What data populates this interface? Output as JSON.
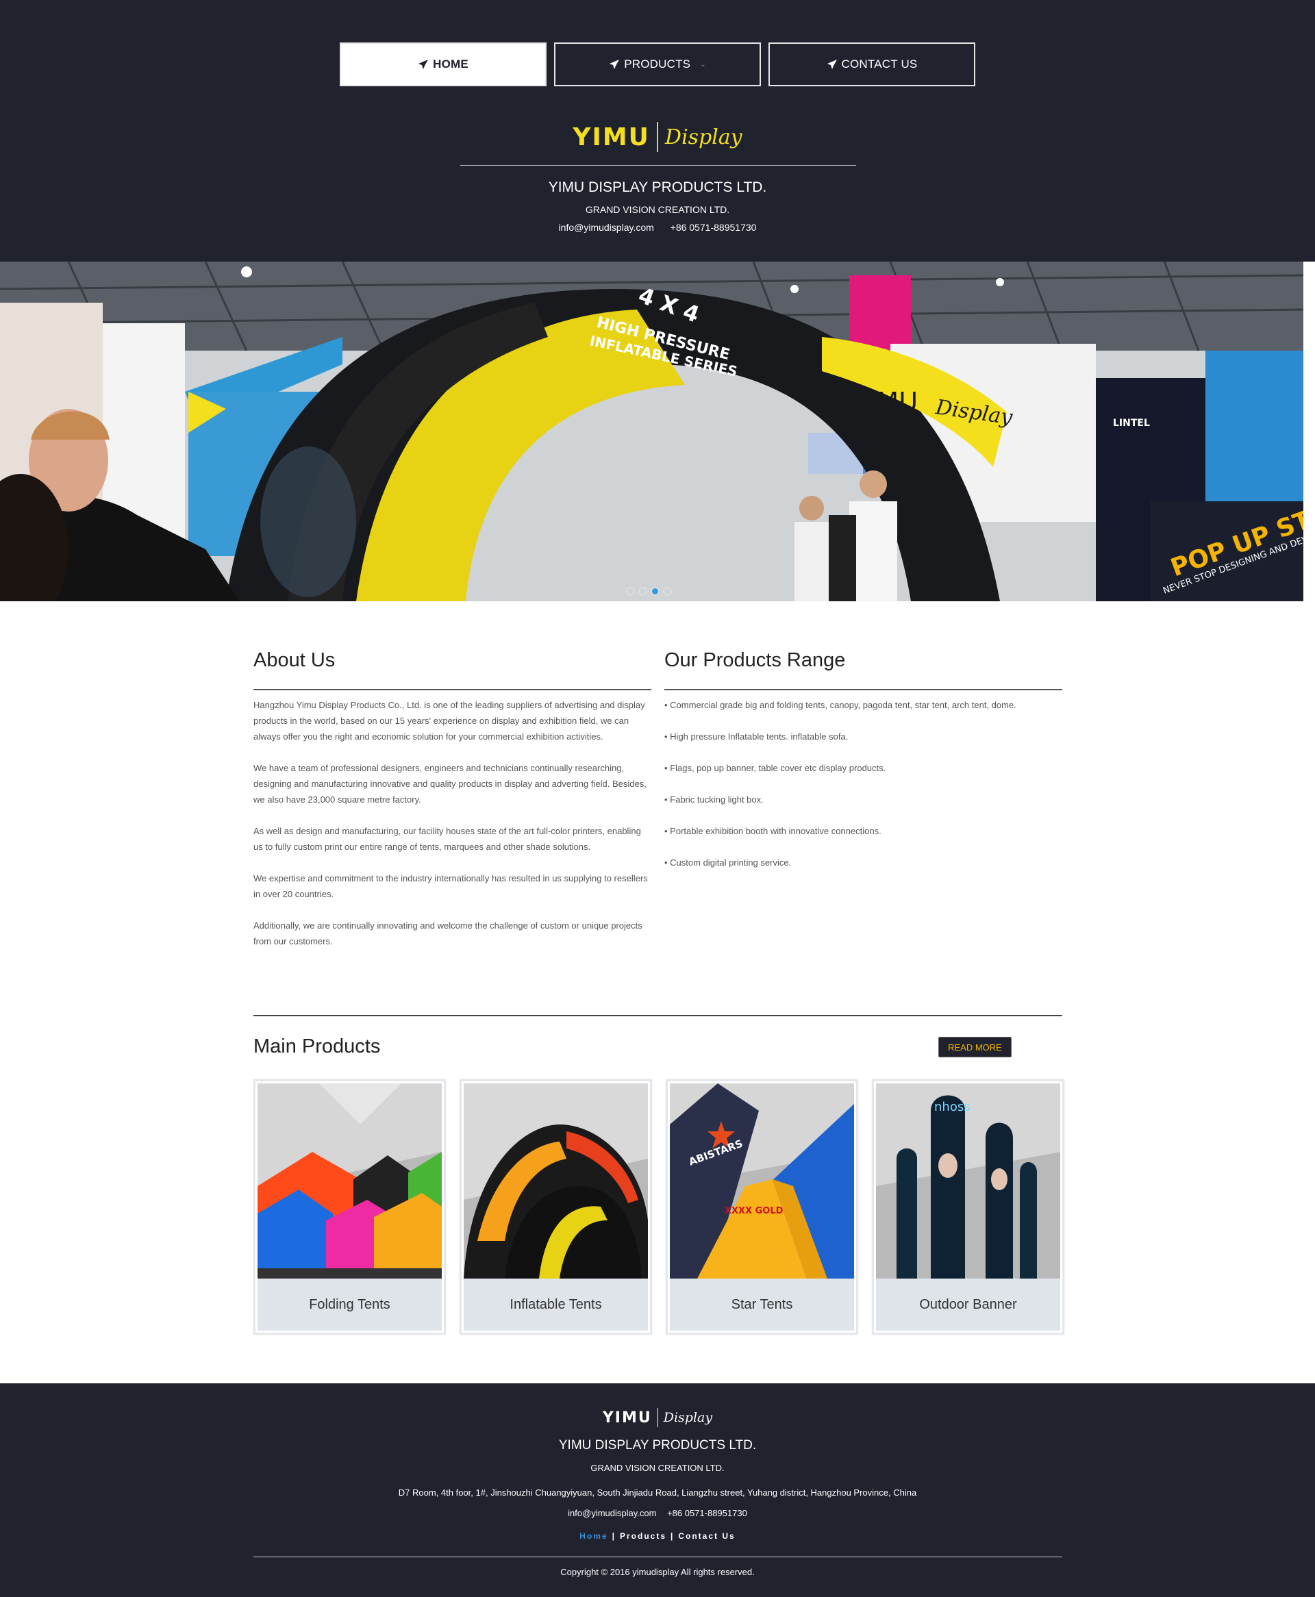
{
  "nav": {
    "items": [
      {
        "label": "HOME"
      },
      {
        "label": "PRODUCTS"
      },
      {
        "label": "CONTACT US"
      }
    ]
  },
  "header": {
    "logo_main": "YIMU",
    "logo_script": "Display",
    "company": "YIMU DISPLAY PRODUCTS LTD.",
    "subcompany": "GRAND VISION CREATION LTD.",
    "email": "info@yimudisplay.com",
    "phone": "+86  0571-88951730"
  },
  "hero": {
    "overlay_top": "4 X 4",
    "overlay_line1": "HIGH PRESSURE",
    "overlay_line2": "INFLATABLE SERIES",
    "arch_brand": "YIMU",
    "arch_script": "Display",
    "popup_line1": "POP UP STAND",
    "popup_line2": "NEVER STOP DESIGNING AND DEVELOPING",
    "lintel": "LINTEL",
    "active_slide": 3,
    "slide_count": 4
  },
  "about": {
    "title": "About Us",
    "paragraphs": [
      "Hangzhou Yimu Display Products Co., Ltd. is one of the leading suppliers of advertising and display products in the world, based on our 15 years' experience on display and exhibition field, we can always offer you the right and economic solution for your commercial exhibition activities.",
      "We have a team of professional designers, engineers and technicians continually researching, designing and manufacturing innovative and quality products in display and adverting field. Besides, we also have 23,000 square metre factory.",
      "As well as design and manufacturing, our facility houses state of the art full-color printers, enabling us to fully custom print our entire range of tents, marquees and other shade solutions.",
      "We expertise and commitment to the industry internationally has resulted in us supplying to resellers in over 20 countries.",
      "Additionally, we are continually innovating and welcome the challenge of custom or unique projects from our customers."
    ]
  },
  "range": {
    "title": "Our Products Range",
    "items": [
      "Commercial grade big and folding tents, canopy, pagoda tent, star tent, arch   tent, dome.",
      "High pressure Inflatable tents. inflatable sofa.",
      "Flags, pop up banner, table cover etc display products.",
      "Fabric tucking light box.",
      "Portable exhibition booth with innovative connections.",
      "Custom digital printing service."
    ]
  },
  "main_products": {
    "title": "Main Products",
    "read_more": "READ MORE",
    "cards": [
      {
        "label": "Folding Tents"
      },
      {
        "label": "Inflatable Tents"
      },
      {
        "label": "Star Tents",
        "print1": "ABISTARS",
        "print2": "XXXX GOLD"
      },
      {
        "label": "Outdoor Banner",
        "print1": "nhoss"
      }
    ]
  },
  "footer": {
    "logo_main": "YIMU",
    "logo_script": "Display",
    "company": "YIMU DISPLAY PRODUCTS LTD.",
    "subcompany": "GRAND VISION CREATION LTD.",
    "address": "D7 Room, 4th foor, 1#, Jinshouzhi Chuangyiyuan, South Jinjiadu Road, Liangzhu street, Yuhang district, Hangzhou Province, China",
    "email": "info@yimudisplay.com",
    "phone": "+86 0571-88951730",
    "links": [
      {
        "label": "Home"
      },
      {
        "label": "Products"
      },
      {
        "label": "Contact Us"
      }
    ],
    "copyright": "Copyright © 2016 yimudisplay All rights reserved."
  },
  "colors": {
    "header_bg": "#20222e",
    "brand_yellow": "#f4df1c",
    "link_blue": "#3a8fd8",
    "dot_active": "#2f9be6",
    "read_more_text": "#f4b400"
  }
}
